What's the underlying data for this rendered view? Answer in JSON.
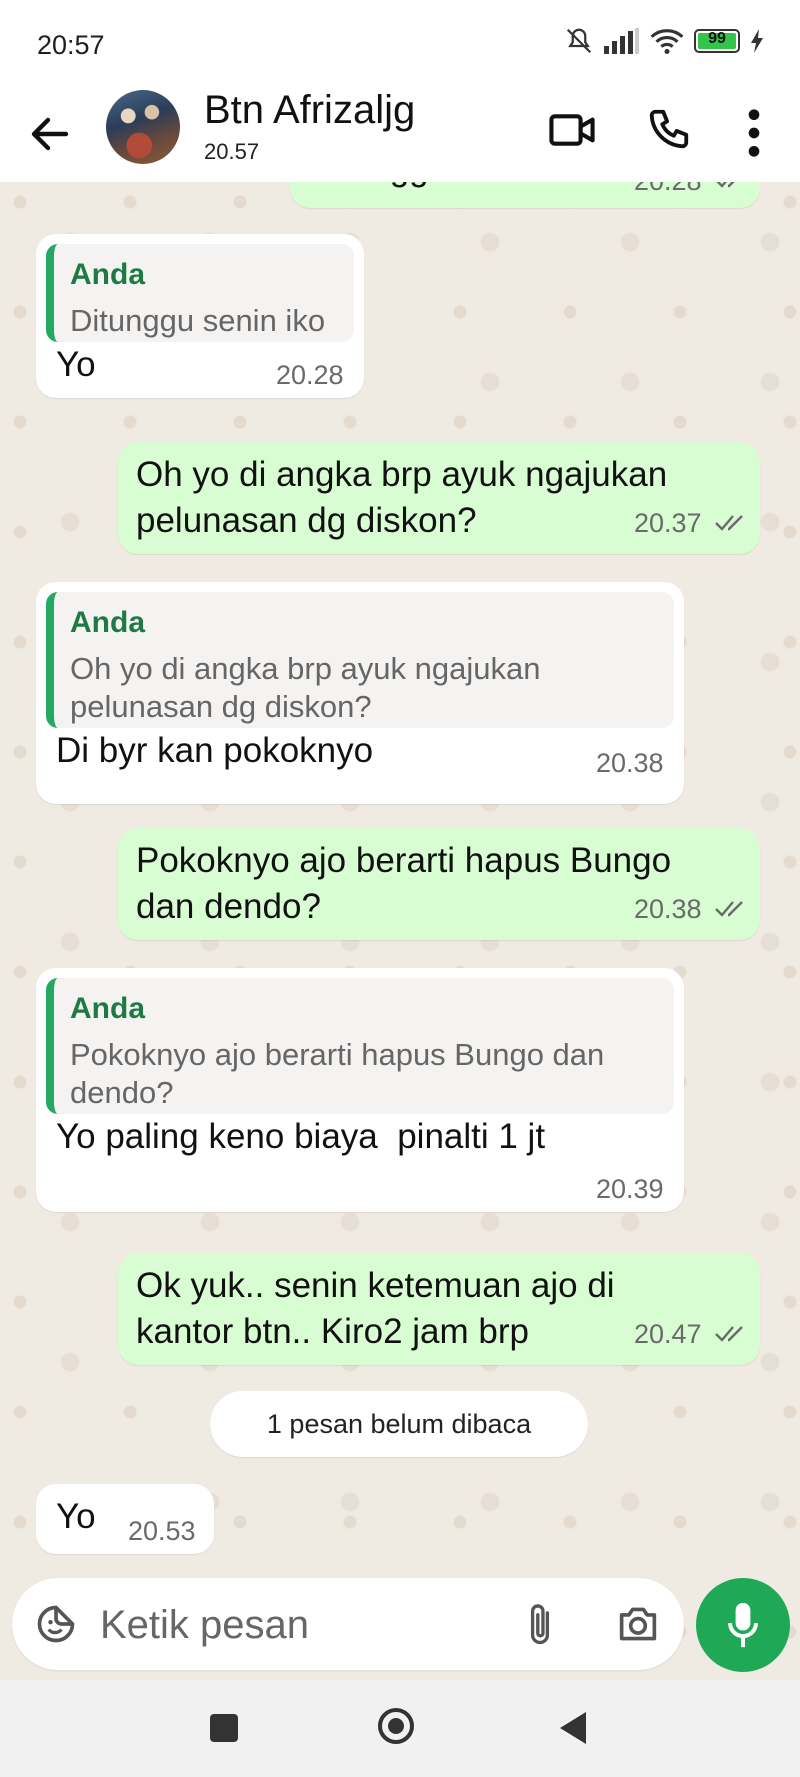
{
  "status_bar": {
    "time": "20:57",
    "battery": "99"
  },
  "header": {
    "contact_name": "Btn Afrizaljg",
    "last_seen": "20.57",
    "icons": [
      "back-arrow-icon",
      "video-call-icon",
      "phone-icon",
      "more-options-icon"
    ]
  },
  "messages": [
    {
      "direction": "out",
      "text": "Ditunggu senin iko",
      "time": "20.28",
      "status": "read"
    },
    {
      "direction": "in",
      "quote_author": "Anda",
      "quote_text": "Ditunggu senin iko",
      "text": "Yo",
      "time": "20.28"
    },
    {
      "direction": "out",
      "text": "Oh yo di angka brp ayuk ngajukan pelunasan dg diskon?",
      "time": "20.37",
      "status": "read"
    },
    {
      "direction": "in",
      "quote_author": "Anda",
      "quote_text": "Oh yo di angka brp ayuk ngajukan pelunasan dg diskon?",
      "text": "Di byr kan pokoknyo",
      "time": "20.38"
    },
    {
      "direction": "out",
      "text": "Pokoknyo ajo berarti hapus Bungo dan dendo?",
      "time": "20.38",
      "status": "read"
    },
    {
      "direction": "in",
      "quote_author": "Anda",
      "quote_text": "Pokoknyo ajo berarti hapus Bungo dan dendo?",
      "text": "Yo paling keno biaya  pinalti 1 jt",
      "time": "20.39"
    },
    {
      "direction": "out",
      "text": "Ok yuk.. senin ketemuan ajo di kantor btn.. Kiro2 jam brp",
      "time": "20.47",
      "status": "read"
    },
    {
      "direction": "in",
      "text": "Yo",
      "time": "20.53"
    }
  ],
  "unread_divider": "1 pesan belum dibaca",
  "composer": {
    "placeholder": "Ketik pesan"
  },
  "colors": {
    "outgoing": "#d9fdd3",
    "incoming": "#ffffff",
    "accent": "#1fa855",
    "chat_bg": "#efeae2"
  }
}
